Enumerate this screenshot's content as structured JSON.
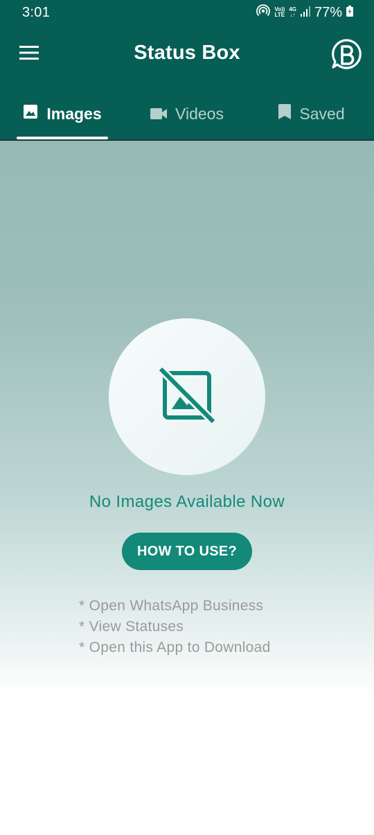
{
  "status_bar": {
    "time": "3:01",
    "volte_label_top": "Vo))",
    "volte_label_bottom": "LTE",
    "network_label": "4G",
    "battery": "77%"
  },
  "toolbar": {
    "title": "Status Box",
    "menu_icon": "hamburger-menu-icon",
    "brand_icon": "whatsapp-business-icon"
  },
  "tabs": [
    {
      "label": "Images",
      "icon": "image-icon",
      "active": true
    },
    {
      "label": "Videos",
      "icon": "videocam-icon",
      "active": false
    },
    {
      "label": "Saved",
      "icon": "bookmark-icon",
      "active": false
    }
  ],
  "empty_state": {
    "icon": "no-image-icon",
    "message": "No Images Available Now",
    "button_label": "HOW TO USE?",
    "steps": [
      "* Open WhatsApp Business",
      "* View Statuses",
      "* Open this App to Download"
    ]
  },
  "colors": {
    "primary": "#075e54",
    "accent": "#13897a",
    "hint_text": "#9a9a9a"
  }
}
